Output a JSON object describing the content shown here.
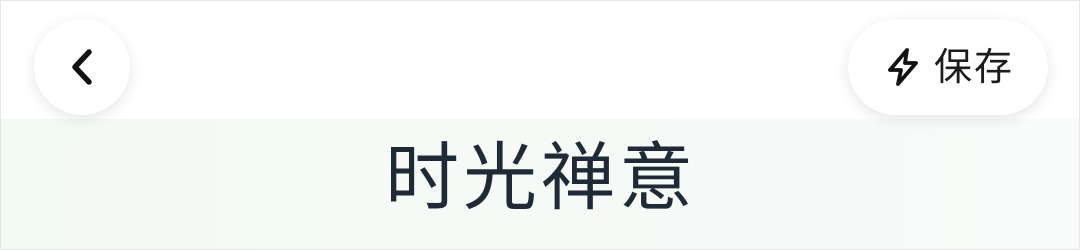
{
  "header": {
    "back_icon": "chevron-left-icon",
    "save_icon": "lightning-bolt-icon",
    "save_label": "保存"
  },
  "main": {
    "title": "时光禅意"
  },
  "colors": {
    "title_text": "#1f2a36",
    "title_area_background": "#f3f9f5",
    "button_background": "#ffffff"
  }
}
